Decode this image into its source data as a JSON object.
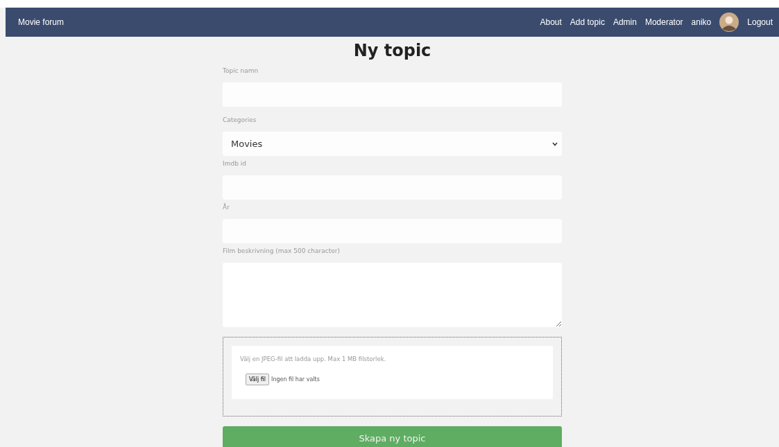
{
  "navbar": {
    "brand": "Movie forum",
    "links": [
      "About",
      "Add topic",
      "Admin",
      "Moderator",
      "aniko"
    ],
    "logout": "Logout"
  },
  "title": "Ny topic",
  "fields": [
    {
      "kind": "input",
      "label": "Topic namn"
    },
    {
      "kind": "select",
      "label": "Categories",
      "value": "Movies"
    },
    {
      "kind": "input",
      "label": "Imdb id"
    },
    {
      "kind": "input",
      "label": "År"
    },
    {
      "kind": "textarea",
      "label": "Film beskrivning (max 500 character)"
    }
  ],
  "upload": {
    "hint": "Välj en JPEG-fil att ladda upp. Max 1 MB filstorlek.",
    "button": "Välj fil",
    "status": "Ingen fil har valts"
  },
  "submit": "Skapa ny topic"
}
